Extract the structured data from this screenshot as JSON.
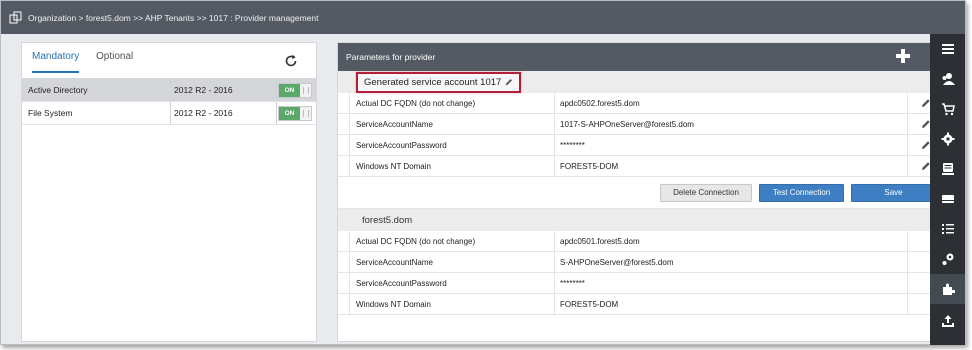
{
  "breadcrumb": "Organization > forest5.dom >> AHP Tenants >> 1017 : Provider management",
  "left_panel": {
    "tabs": [
      {
        "label": "Mandatory",
        "active": true
      },
      {
        "label": "Optional",
        "active": false
      }
    ],
    "providers": [
      {
        "name": "Active Directory",
        "version": "2012 R2 - 2016",
        "state": "ON",
        "selected": true
      },
      {
        "name": "File System",
        "version": "2012 R2 - 2016",
        "state": "ON",
        "selected": false
      }
    ]
  },
  "right_panel": {
    "title": "Parameters for provider",
    "sections": [
      {
        "title": "Generated service account 1017",
        "rows": [
          {
            "key": "Actual DC FQDN (do not change)",
            "value": "apdc0502.forest5.dom"
          },
          {
            "key": "ServiceAccountName",
            "value": "1017-S-AHPOneServer@forest5.dom"
          },
          {
            "key": "ServiceAccountPassword",
            "value": "********"
          },
          {
            "key": "Windows NT Domain",
            "value": "FOREST5-DOM"
          }
        ],
        "buttons": {
          "delete": "Delete Connection",
          "test": "Test Connection",
          "save": "Save"
        }
      },
      {
        "title": "forest5.dom",
        "rows": [
          {
            "key": "Actual DC FQDN (do not change)",
            "value": "apdc0501.forest5.dom"
          },
          {
            "key": "ServiceAccountName",
            "value": "S-AHPOneServer@forest5.dom"
          },
          {
            "key": "ServiceAccountPassword",
            "value": "********"
          },
          {
            "key": "Windows NT Domain",
            "value": "FOREST5-DOM"
          }
        ]
      }
    ]
  },
  "sidebar_icons": [
    "list-icon",
    "users-icon",
    "cart-icon",
    "gear-icon",
    "monitor-icon",
    "card-icon",
    "checklist-icon",
    "settings-cog-icon",
    "puzzle-icon",
    "upload-icon"
  ],
  "colors": {
    "topbar": "#545a63",
    "accent": "#2474b5",
    "button_blue": "#3d7fc2",
    "toggle_on": "#5aa86a",
    "highlight": "#b0203a",
    "sidebar": "#2c3035"
  }
}
